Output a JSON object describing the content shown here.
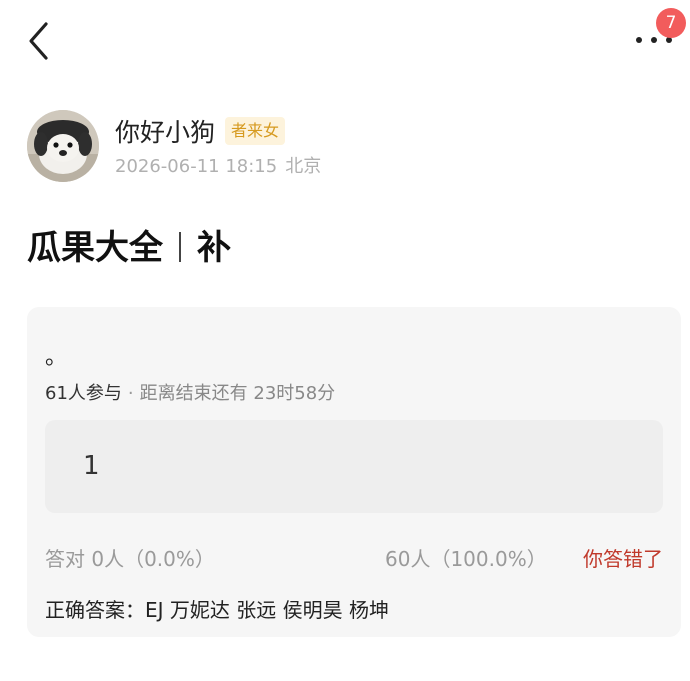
{
  "topbar": {
    "back_icon": "chevron-left-icon",
    "more_icon": "more-dots-icon",
    "badge_count": "7",
    "badge_color": "#f25c5c"
  },
  "author": {
    "name": "你好小狗",
    "tag": "者来女",
    "timestamp": "2026-06-11 18:15",
    "location": "北京"
  },
  "post": {
    "title_main": "瓜果大全",
    "title_suffix": "补"
  },
  "poll": {
    "question": "。",
    "participants": "61人参与",
    "deadline": "距离结束还有 23时58分",
    "option": "1",
    "correct_stat": "答对  0人（0.0%）",
    "option_stat": "60人（100.0%）",
    "result": "你答错了",
    "correct_answer": "正确答案：EJ 万妮达 张远 侯明昊 杨坤"
  },
  "colors": {
    "accent_red": "#c0392b",
    "tag_text": "#d69a1f",
    "tag_bg": "#fdf3dc"
  }
}
